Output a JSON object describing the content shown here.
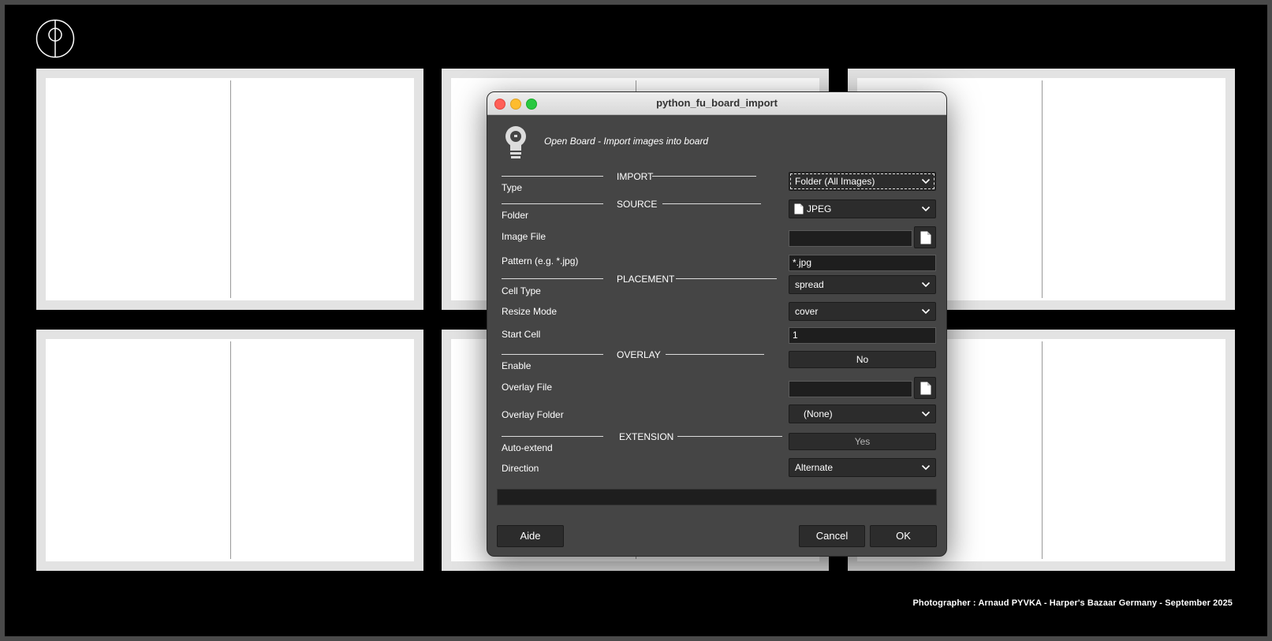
{
  "credit": "Photographer : Arnaud PYVKA - Harper's Bazaar Germany - September 2025",
  "dialog": {
    "title": "python_fu_board_import",
    "header_text": "Open Board - Import images into board",
    "sections": {
      "import": "IMPORT",
      "source": "SOURCE",
      "placement": "PLACEMENT",
      "overlay": "OVERLAY",
      "extension": "EXTENSION"
    },
    "labels": {
      "type": "Type",
      "folder": "Folder",
      "image_file": "Image File",
      "pattern": "Pattern (e.g. *.jpg)",
      "cell_type": "Cell Type",
      "resize_mode": "Resize Mode",
      "start_cell": "Start Cell",
      "enable": "Enable",
      "overlay_file": "Overlay File",
      "overlay_folder": "Overlay Folder",
      "auto_extend": "Auto-extend",
      "direction": "Direction"
    },
    "values": {
      "type": "Folder (All Images)",
      "folder": "JPEG",
      "image_file": "",
      "pattern": "*.jpg",
      "cell_type": "spread",
      "resize_mode": "cover",
      "start_cell": "1",
      "enable": "No",
      "overlay_file": "",
      "overlay_folder": "(None)",
      "auto_extend": "Yes",
      "direction": "Alternate"
    },
    "buttons": {
      "help": "Aide",
      "cancel": "Cancel",
      "ok": "OK"
    }
  }
}
